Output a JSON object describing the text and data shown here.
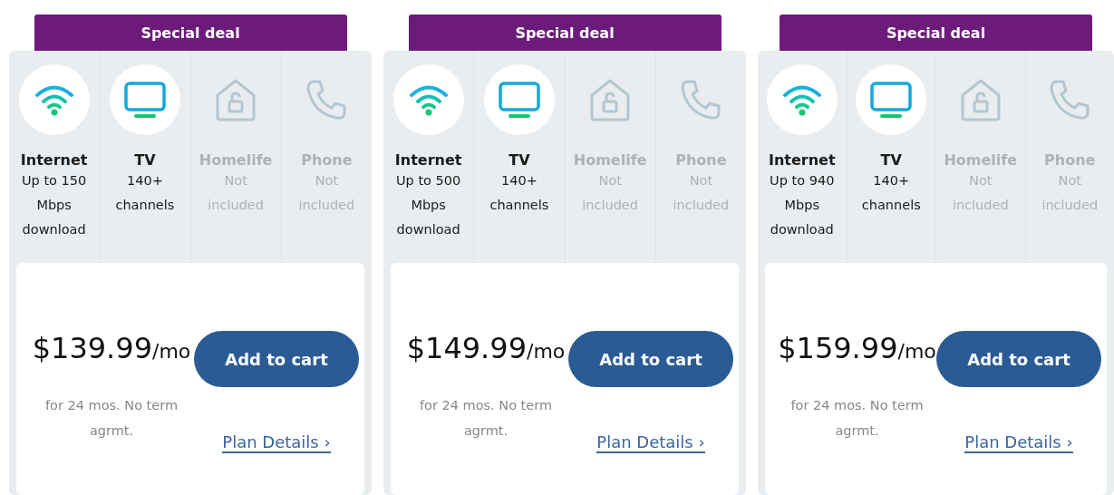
{
  "plans": [
    {
      "banner": "Special deal",
      "features": [
        {
          "kind": "internet",
          "title": "Internet",
          "detail": "Up to 150 Mbps download",
          "included": true
        },
        {
          "kind": "tv",
          "title": "TV",
          "detail": "140+ channels",
          "included": true
        },
        {
          "kind": "homelife",
          "title": "Homelife",
          "detail": "Not included",
          "included": false
        },
        {
          "kind": "phone",
          "title": "Phone",
          "detail": "Not included",
          "included": false
        }
      ],
      "price": "$139.99",
      "period": "/mo",
      "note": "for 24 mos. No term agrmt.",
      "button": "Add to cart",
      "link": "Plan Details ›"
    },
    {
      "banner": "Special deal",
      "features": [
        {
          "kind": "internet",
          "title": "Internet",
          "detail": "Up to 500 Mbps download",
          "included": true
        },
        {
          "kind": "tv",
          "title": "TV",
          "detail": "140+ channels",
          "included": true
        },
        {
          "kind": "homelife",
          "title": "Homelife",
          "detail": "Not included",
          "included": false
        },
        {
          "kind": "phone",
          "title": "Phone",
          "detail": "Not included",
          "included": false
        }
      ],
      "price": "$149.99",
      "period": "/mo",
      "note": "for 24 mos. No term agrmt.",
      "button": "Add to cart",
      "link": "Plan Details ›"
    },
    {
      "banner": "Special deal",
      "features": [
        {
          "kind": "internet",
          "title": "Internet",
          "detail": "Up to 940 Mbps download",
          "included": true
        },
        {
          "kind": "tv",
          "title": "TV",
          "detail": "140+ channels",
          "included": true
        },
        {
          "kind": "homelife",
          "title": "Homelife",
          "detail": "Not included",
          "included": false
        },
        {
          "kind": "phone",
          "title": "Phone",
          "detail": "Not included",
          "included": false
        }
      ],
      "price": "$159.99",
      "period": "/mo",
      "note": "for 24 mos. No term agrmt.",
      "button": "Add to cart",
      "link": "Plan Details ›"
    }
  ]
}
